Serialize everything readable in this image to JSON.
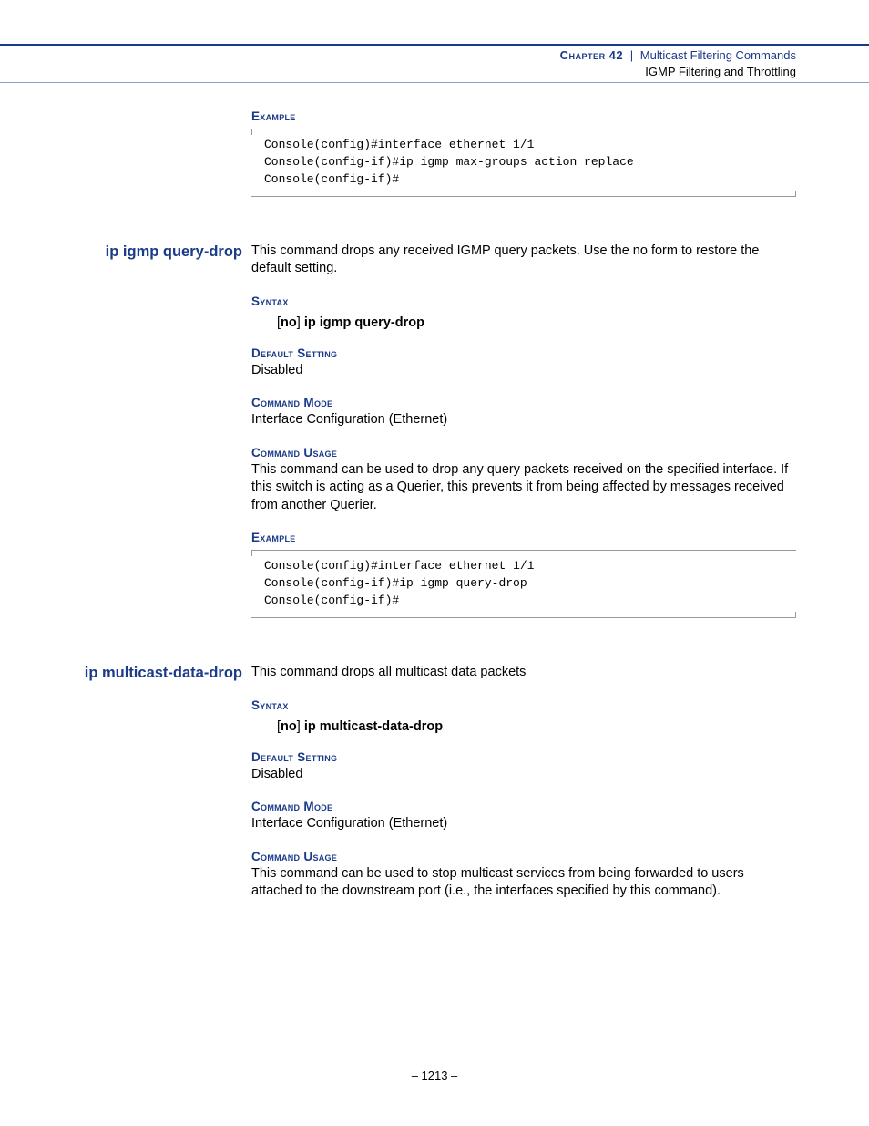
{
  "header": {
    "chapter_label": "Chapter 42",
    "separator": "|",
    "chapter_title": "Multicast Filtering Commands",
    "subtitle": "IGMP Filtering and Throttling"
  },
  "sections": {
    "s0": {
      "example_label": "Example",
      "code": "Console(config)#interface ethernet 1/1\nConsole(config-if)#ip igmp max-groups action replace\nConsole(config-if)#"
    },
    "s1": {
      "cmd": "ip igmp query-drop",
      "intro": "This command drops any received IGMP query packets. Use the no form to restore the default setting.",
      "syntax_label": "Syntax",
      "syntax_no": "no",
      "syntax_cmd": "ip igmp query-drop",
      "default_label": "Default Setting",
      "default_val": "Disabled",
      "mode_label": "Command Mode",
      "mode_val": "Interface Configuration (Ethernet)",
      "usage_label": "Command Usage",
      "usage_text": "This command can be used to drop any query packets received on the specified interface. If this switch is acting as a Querier, this prevents it from being affected by messages received from another Querier.",
      "example_label": "Example",
      "code": "Console(config)#interface ethernet 1/1\nConsole(config-if)#ip igmp query-drop\nConsole(config-if)#"
    },
    "s2": {
      "cmd": "ip multicast-data-drop",
      "intro": "This command drops all multicast data packets",
      "syntax_label": "Syntax",
      "syntax_no": "no",
      "syntax_cmd": "ip multicast-data-drop",
      "default_label": "Default Setting",
      "default_val": "Disabled",
      "mode_label": "Command Mode",
      "mode_val": "Interface Configuration (Ethernet)",
      "usage_label": "Command Usage",
      "usage_text": "This command can be used to stop multicast services from being forwarded to users attached to the downstream port (i.e., the interfaces specified by this command)."
    }
  },
  "footer": {
    "page": "–  1213  –"
  }
}
